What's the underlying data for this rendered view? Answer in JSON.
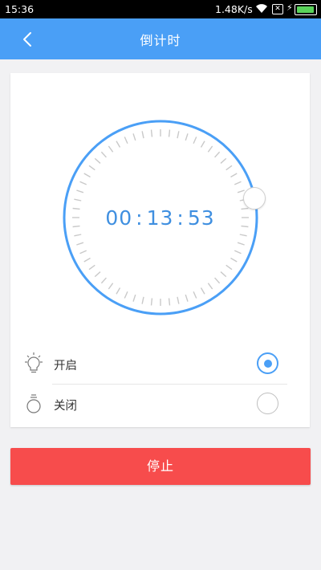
{
  "status_bar": {
    "time": "15:36",
    "network_speed": "1.48K/s",
    "sim_icon": "sim-x-icon",
    "charging_icon": "lightning-icon",
    "battery_color": "#59d35a"
  },
  "header": {
    "title": "倒计时",
    "back_icon": "chevron-left-icon",
    "background": "#4a9ff6"
  },
  "timer": {
    "hours": "00",
    "minutes": "13",
    "seconds": "53",
    "separator": ":",
    "ring_color": "#4a9ff6",
    "tick_color": "#c9c9c9"
  },
  "options": [
    {
      "label": "开启",
      "icon": "lightbulb-icon",
      "selected": true
    },
    {
      "label": "关闭",
      "icon": "ring-timer-icon",
      "selected": false
    }
  ],
  "stop_button": {
    "label": "停止",
    "color": "#f74c4c"
  }
}
